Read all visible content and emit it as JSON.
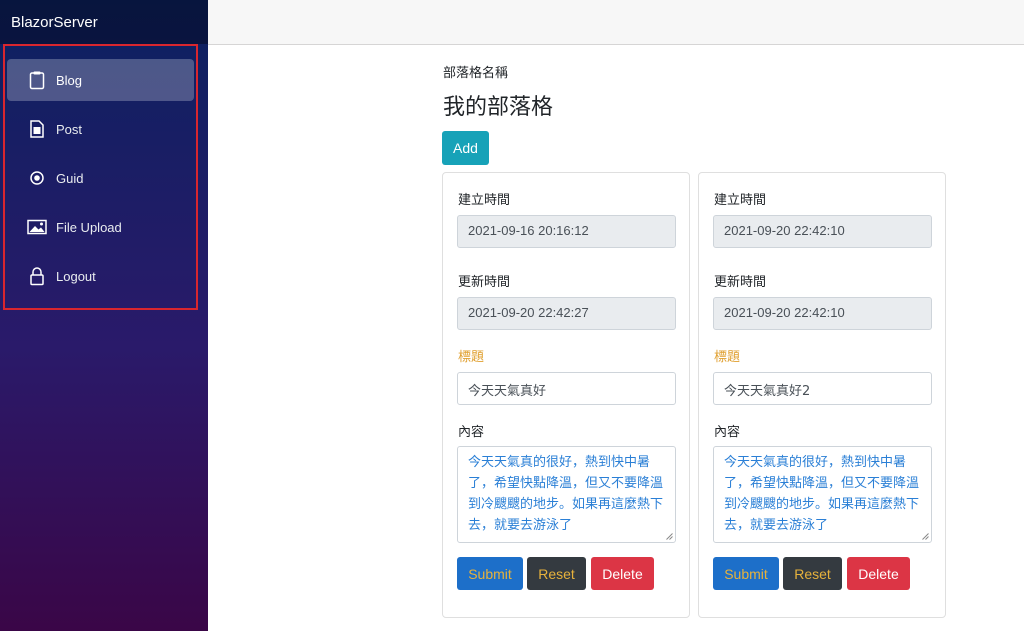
{
  "sidebar": {
    "brand": "BlazorServer",
    "items": [
      {
        "label": "Blog",
        "icon": "clipboard-icon",
        "active": true
      },
      {
        "label": "Post",
        "icon": "document-icon",
        "active": false
      },
      {
        "label": "Guid",
        "icon": "radio-icon",
        "active": false
      },
      {
        "label": "File Upload",
        "icon": "image-icon",
        "active": false
      },
      {
        "label": "Logout",
        "icon": "lock-icon",
        "active": false
      }
    ]
  },
  "main": {
    "blog_name_label": "部落格名稱",
    "blog_name": "我的部落格",
    "add_label": "Add",
    "field_labels": {
      "created": "建立時間",
      "updated": "更新時間",
      "title": "標題",
      "content": "內容"
    },
    "buttons": {
      "submit": "Submit",
      "reset": "Reset",
      "delete": "Delete"
    },
    "posts": [
      {
        "created": "2021-09-16 20:16:12",
        "updated": "2021-09-20 22:42:27",
        "title": "今天天氣真好",
        "content": "今天天氣真的很好，熱到快中暑了，希望快點降溫，但又不要降溫到冷颼颼的地步。如果再這麼熱下去，就要去游泳了"
      },
      {
        "created": "2021-09-20 22:42:10",
        "updated": "2021-09-20 22:42:10",
        "title": "今天天氣真好2",
        "content": "今天天氣真的很好，熱到快中暑了，希望快點降溫，但又不要降溫到冷颼颼的地步。如果再這麼熱下去，就要去游泳了"
      }
    ]
  },
  "colors": {
    "accent_info": "#17a2b8",
    "primary": "#1d6fc9",
    "dark": "#343a40",
    "danger": "#dc3545",
    "title_label": "#e0a030",
    "highlight_border": "#d9262e"
  }
}
